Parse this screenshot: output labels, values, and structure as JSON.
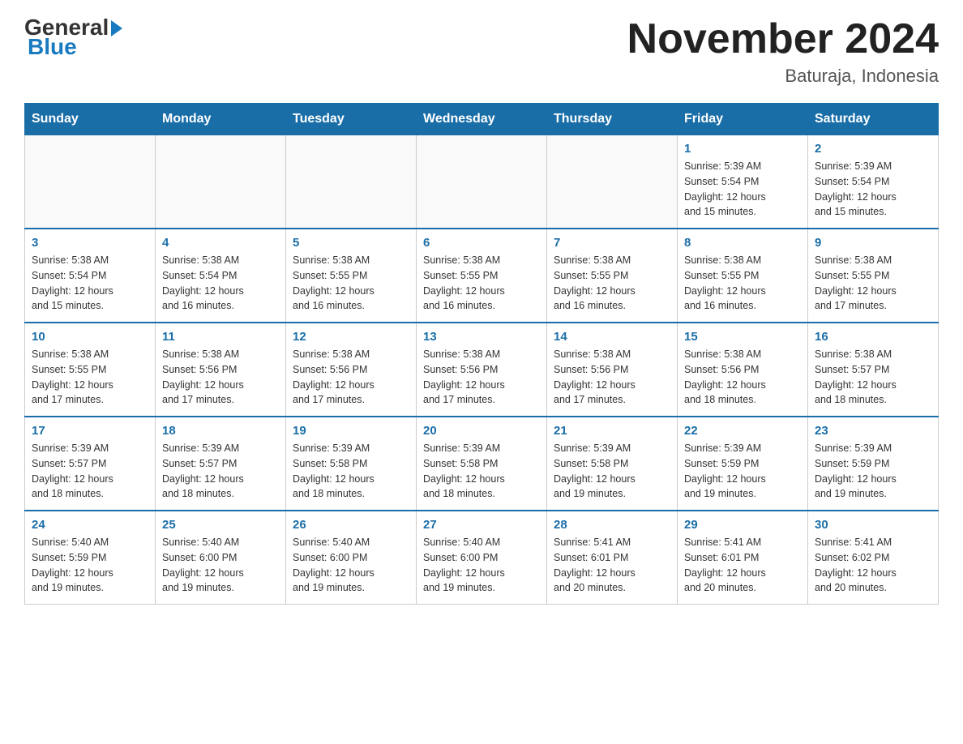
{
  "header": {
    "logo_general": "General",
    "logo_blue": "Blue",
    "month_title": "November 2024",
    "location": "Baturaja, Indonesia"
  },
  "days_of_week": [
    "Sunday",
    "Monday",
    "Tuesday",
    "Wednesday",
    "Thursday",
    "Friday",
    "Saturday"
  ],
  "weeks": [
    [
      {
        "day": "",
        "info": ""
      },
      {
        "day": "",
        "info": ""
      },
      {
        "day": "",
        "info": ""
      },
      {
        "day": "",
        "info": ""
      },
      {
        "day": "",
        "info": ""
      },
      {
        "day": "1",
        "info": "Sunrise: 5:39 AM\nSunset: 5:54 PM\nDaylight: 12 hours\nand 15 minutes."
      },
      {
        "day": "2",
        "info": "Sunrise: 5:39 AM\nSunset: 5:54 PM\nDaylight: 12 hours\nand 15 minutes."
      }
    ],
    [
      {
        "day": "3",
        "info": "Sunrise: 5:38 AM\nSunset: 5:54 PM\nDaylight: 12 hours\nand 15 minutes."
      },
      {
        "day": "4",
        "info": "Sunrise: 5:38 AM\nSunset: 5:54 PM\nDaylight: 12 hours\nand 16 minutes."
      },
      {
        "day": "5",
        "info": "Sunrise: 5:38 AM\nSunset: 5:55 PM\nDaylight: 12 hours\nand 16 minutes."
      },
      {
        "day": "6",
        "info": "Sunrise: 5:38 AM\nSunset: 5:55 PM\nDaylight: 12 hours\nand 16 minutes."
      },
      {
        "day": "7",
        "info": "Sunrise: 5:38 AM\nSunset: 5:55 PM\nDaylight: 12 hours\nand 16 minutes."
      },
      {
        "day": "8",
        "info": "Sunrise: 5:38 AM\nSunset: 5:55 PM\nDaylight: 12 hours\nand 16 minutes."
      },
      {
        "day": "9",
        "info": "Sunrise: 5:38 AM\nSunset: 5:55 PM\nDaylight: 12 hours\nand 17 minutes."
      }
    ],
    [
      {
        "day": "10",
        "info": "Sunrise: 5:38 AM\nSunset: 5:55 PM\nDaylight: 12 hours\nand 17 minutes."
      },
      {
        "day": "11",
        "info": "Sunrise: 5:38 AM\nSunset: 5:56 PM\nDaylight: 12 hours\nand 17 minutes."
      },
      {
        "day": "12",
        "info": "Sunrise: 5:38 AM\nSunset: 5:56 PM\nDaylight: 12 hours\nand 17 minutes."
      },
      {
        "day": "13",
        "info": "Sunrise: 5:38 AM\nSunset: 5:56 PM\nDaylight: 12 hours\nand 17 minutes."
      },
      {
        "day": "14",
        "info": "Sunrise: 5:38 AM\nSunset: 5:56 PM\nDaylight: 12 hours\nand 17 minutes."
      },
      {
        "day": "15",
        "info": "Sunrise: 5:38 AM\nSunset: 5:56 PM\nDaylight: 12 hours\nand 18 minutes."
      },
      {
        "day": "16",
        "info": "Sunrise: 5:38 AM\nSunset: 5:57 PM\nDaylight: 12 hours\nand 18 minutes."
      }
    ],
    [
      {
        "day": "17",
        "info": "Sunrise: 5:39 AM\nSunset: 5:57 PM\nDaylight: 12 hours\nand 18 minutes."
      },
      {
        "day": "18",
        "info": "Sunrise: 5:39 AM\nSunset: 5:57 PM\nDaylight: 12 hours\nand 18 minutes."
      },
      {
        "day": "19",
        "info": "Sunrise: 5:39 AM\nSunset: 5:58 PM\nDaylight: 12 hours\nand 18 minutes."
      },
      {
        "day": "20",
        "info": "Sunrise: 5:39 AM\nSunset: 5:58 PM\nDaylight: 12 hours\nand 18 minutes."
      },
      {
        "day": "21",
        "info": "Sunrise: 5:39 AM\nSunset: 5:58 PM\nDaylight: 12 hours\nand 19 minutes."
      },
      {
        "day": "22",
        "info": "Sunrise: 5:39 AM\nSunset: 5:59 PM\nDaylight: 12 hours\nand 19 minutes."
      },
      {
        "day": "23",
        "info": "Sunrise: 5:39 AM\nSunset: 5:59 PM\nDaylight: 12 hours\nand 19 minutes."
      }
    ],
    [
      {
        "day": "24",
        "info": "Sunrise: 5:40 AM\nSunset: 5:59 PM\nDaylight: 12 hours\nand 19 minutes."
      },
      {
        "day": "25",
        "info": "Sunrise: 5:40 AM\nSunset: 6:00 PM\nDaylight: 12 hours\nand 19 minutes."
      },
      {
        "day": "26",
        "info": "Sunrise: 5:40 AM\nSunset: 6:00 PM\nDaylight: 12 hours\nand 19 minutes."
      },
      {
        "day": "27",
        "info": "Sunrise: 5:40 AM\nSunset: 6:00 PM\nDaylight: 12 hours\nand 19 minutes."
      },
      {
        "day": "28",
        "info": "Sunrise: 5:41 AM\nSunset: 6:01 PM\nDaylight: 12 hours\nand 20 minutes."
      },
      {
        "day": "29",
        "info": "Sunrise: 5:41 AM\nSunset: 6:01 PM\nDaylight: 12 hours\nand 20 minutes."
      },
      {
        "day": "30",
        "info": "Sunrise: 5:41 AM\nSunset: 6:02 PM\nDaylight: 12 hours\nand 20 minutes."
      }
    ]
  ]
}
